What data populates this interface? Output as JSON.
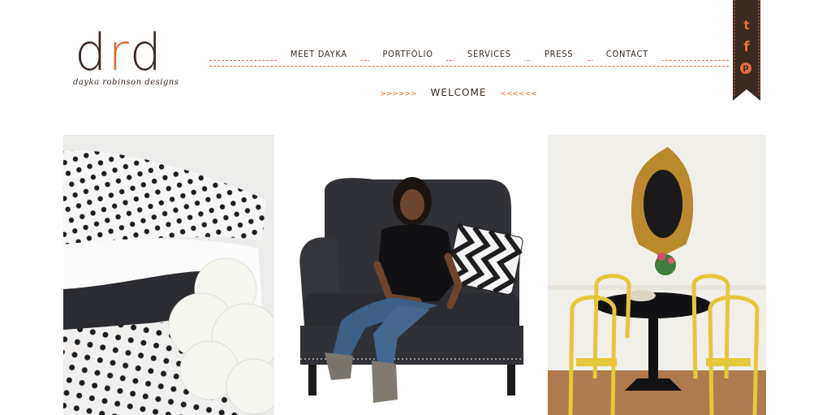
{
  "logo": {
    "mark": "drd",
    "tagline": "dayka robinson designs"
  },
  "nav": {
    "items": [
      "MEET DAYKA",
      "PORTFOLIO",
      "SERVICES",
      "PRESS",
      "CONTACT"
    ]
  },
  "welcome": {
    "left_arrows": ">>>>>>",
    "label": "WELCOME",
    "right_arrows": "<<<<<<"
  },
  "social": {
    "twitter": "t",
    "facebook": "f",
    "pinterest": "p"
  },
  "colors": {
    "accent": "#e0703a",
    "brown": "#3b2a22"
  },
  "icons": [
    "twitter-icon",
    "facebook-icon",
    "pinterest-icon"
  ]
}
